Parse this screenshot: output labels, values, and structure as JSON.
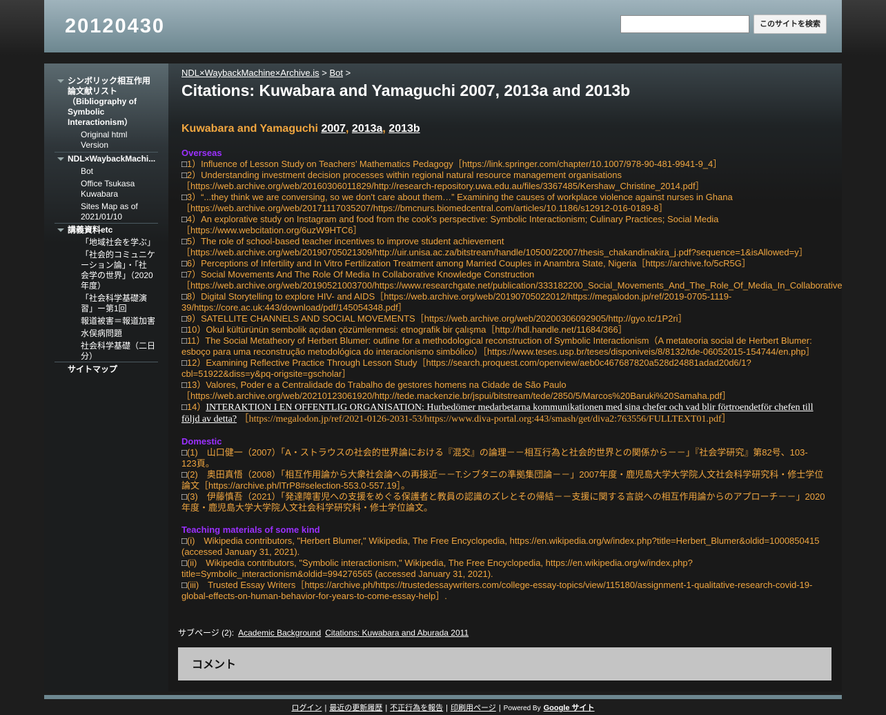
{
  "header": {
    "site_title": "20120430",
    "search_placeholder": "",
    "search_button": "このサイトを検索"
  },
  "sidebar": {
    "groups": [
      {
        "label": "シンボリック相互作用論文献リスト（Bibliography of Symbolic Interactionism）",
        "label_lines": [
          "シンボリック相互作用",
          "論文献リスト",
          "（Bibliography of",
          "Symbolic",
          "Interactionism）"
        ],
        "items": [
          [
            "Original html",
            "Version"
          ]
        ]
      },
      {
        "label": "NDL×WaybackMachi...",
        "items": [
          [
            "Bot"
          ],
          [
            "Office Tsukasa",
            "Kuwabara"
          ],
          [
            "Sites Map as of",
            "2021/01/10"
          ]
        ]
      },
      {
        "label": "講義資料etc",
        "items": [
          [
            "「地域社会を学ぶ」"
          ],
          [
            "「社会的コミュニケ",
            "ーション論」・「社",
            "会学の世界」（2020",
            "年度）"
          ],
          [
            "「社会科学基礎演",
            "習」ー第1回"
          ],
          [
            "報道被害＝報道加害"
          ],
          [
            "水俣病問題"
          ],
          [
            "社会科学基礎（二日",
            "分）"
          ]
        ]
      }
    ],
    "sitemap_label": "サイトマップ"
  },
  "breadcrumb": {
    "parent": "NDL×WaybackMachine×Archive.is",
    "sep1": " > ",
    "child": "Bot",
    "sep2": " >"
  },
  "page_title": "Citations: Kuwabara and Yamaguchi 2007, 2013a and 2013b",
  "section_heading": {
    "prefix": "Kuwabara and Yamaguchi ",
    "links": [
      "2007",
      "2013a",
      "2013b"
    ]
  },
  "overseas": {
    "title": "Overseas",
    "lines": [
      [
        "1）Influence of Lesson Study on Teachers’ Mathematics Pedagogy［https://link.springer.com/chapter/10.1007/978-90-481-9941-9_4］"
      ],
      [
        "2）Understanding investment decision processes within regional natural resource management organisations",
        "［https://web.archive.org/web/20160306011829/http://research-repository.uwa.edu.au/files/3367485/Kershaw_Christine_2014.pdf］"
      ],
      [
        "3）“...they think we are conversing, so we don't care about them…” Examining the causes of workplace violence against nurses in Ghana",
        "［https://web.archive.org/web/20171117035207/https://bmcnurs.biomedcentral.com/articles/10.1186/s12912-016-0189-8］"
      ],
      [
        "4）An explorative study on Instagram and food from the cook's perspective: Symbolic Interactionism; Culinary Practices; Social Media",
        "［https://www.webcitation.org/6uzW9HTC6］"
      ],
      [
        "5）The role of school-based teacher incentives to improve student achievement",
        "［https://web.archive.org/web/20190705021309/http://uir.unisa.ac.za/bitstream/handle/10500/22007/thesis_chakandinakira_j.pdf?sequence=1&isAllowed=y］"
      ],
      [
        "6）Perceptions of Infertility and In Vitro Fertilization Treatment among Married Couples in Anambra State, Nigeria［https://archive.fo/5cR5G］"
      ],
      [
        "7）Social Movements And The Role Of Media In Collaborative Knowledge Construction",
        "［https://web.archive.org/web/20190521003700/https://www.researchgate.net/publication/333182200_Social_Movements_And_The_Role_Of_Media_In_Collaborative"
      ],
      [
        "8）Digital Storytelling to explore HIV- and AIDS［https://web.archive.org/web/20190705022012/https://megalodon.jp/ref/2019-0705-1119-",
        "39/https://core.ac.uk:443/download/pdf/145054348.pdf］"
      ],
      [
        "9）SATELLITE CHANNELS AND SOCIAL MOVEMENTS［https://web.archive.org/web/20200306092905/http://gyo.tc/1P2ri］"
      ],
      [
        "10）Okul kültürünün sembolik açıdan çözümlenmesi: etnografik bir çalışma［http://hdl.handle.net/11684/366］"
      ],
      [
        "11）The Social Metatheory of Herbert Blumer: outline for a methodological reconstruction of Symbolic Interactionism（A metateoria social de Herbert Blumer:",
        "esboço para uma reconstrução metodológica do interacionismo simbólico）［https://www.teses.usp.br/teses/disponiveis/8/8132/tde-06052015-154744/en.php］"
      ],
      [
        "12）Examining Reflective Practice Through Lesson Study［https://search.proquest.com/openview/aeb0c467687820a528d24881adad20d6/1?",
        "cbl=51922&diss=y&pq-origsite=gscholar］"
      ],
      [
        "13）Valores, Poder e a Centralidade do Trabalho de gestores homens na Cidade de São Paulo",
        "［https://web.archive.org/web/20210123061920/http://tede.mackenzie.br/jspui/bitstream/tede/2850/5/Marcos%20Baruki%20Samaha.pdf］"
      ]
    ],
    "item14": {
      "prefix": "14）",
      "link_line1": "INTERAKTION I EN OFFENTLIG ORGANISATION: Hurbedömer medarbetarna kommunikationen med sina chefer och vad blir förtroendetför chefen till",
      "link_line2": "följd av detta?",
      "tail": "［https://megalodon.jp/ref/2021-0126-2031-53/https://www.diva-portal.org:443/smash/get/diva2:763556/FULLTEXT01.pdf］"
    }
  },
  "domestic": {
    "title": "Domestic",
    "lines": [
      [
        "(1)　山口健一（2007）「A・ストラウスの社会的世界論における『混交』の論理－－相互行為と社会的世界との関係から－－」『社会学研究』第82号、103-",
        "123頁。"
      ],
      [
        "(2)　奥田真悟（2008）「相互作用論から大衆社会論への再接近－－T.シブタニの準拠集団論－－」2007年度・鹿児島大学大学院人文社会科学研究科・修士学位",
        "論文［https://archive.ph/lTrP8#selection-553.0-557.19］。"
      ],
      [
        "(3)　伊藤慎吾（2021）「発達障害児への支援をめぐる保護者と教員の認識のズレとその帰結－－支援に関する言説への相互作用論からのアプローチ－－」2020",
        "年度・鹿児島大学大学院人文社会科学研究科・修士学位論文。"
      ]
    ]
  },
  "teaching": {
    "title": "Teaching materials of some kind",
    "lines": [
      [
        "(i)　Wikipedia contributors, \"Herbert Blumer,\" Wikipedia, The Free Encyclopedia, https://en.wikipedia.org/w/index.php?title=Herbert_Blumer&oldid=1000850415",
        "(accessed January 31, 2021)."
      ],
      [
        "(ii)　Wikipedia contributors, \"Symbolic interactionism,\" Wikipedia, The Free Encyclopedia, https://en.wikipedia.org/w/index.php?",
        "title=Symbolic_interactionism&oldid=994276565 (accessed January 31, 2021)."
      ],
      [
        "(iii)　Trusted Essay Writers［https://archive.ph/https://trustedessaywriters.com/college-essay-topics/view/115180/assignment-1-qualitative-research-covid-19-",
        "global-effects-on-human-behavior-for-years-to-come-essay-help］."
      ]
    ]
  },
  "box_glyph": "□",
  "subpages": {
    "label": "サブページ (2):",
    "links": [
      "Academic Background",
      "Citations: Kuwabara and Aburada 2011"
    ]
  },
  "comment_title": "コメント",
  "footer": {
    "links": [
      "ログイン",
      "最近の更新履歴",
      "不正行為を報告",
      "印刷用ページ"
    ],
    "powered_by": "Powered By",
    "google_sites": "Google サイト"
  }
}
